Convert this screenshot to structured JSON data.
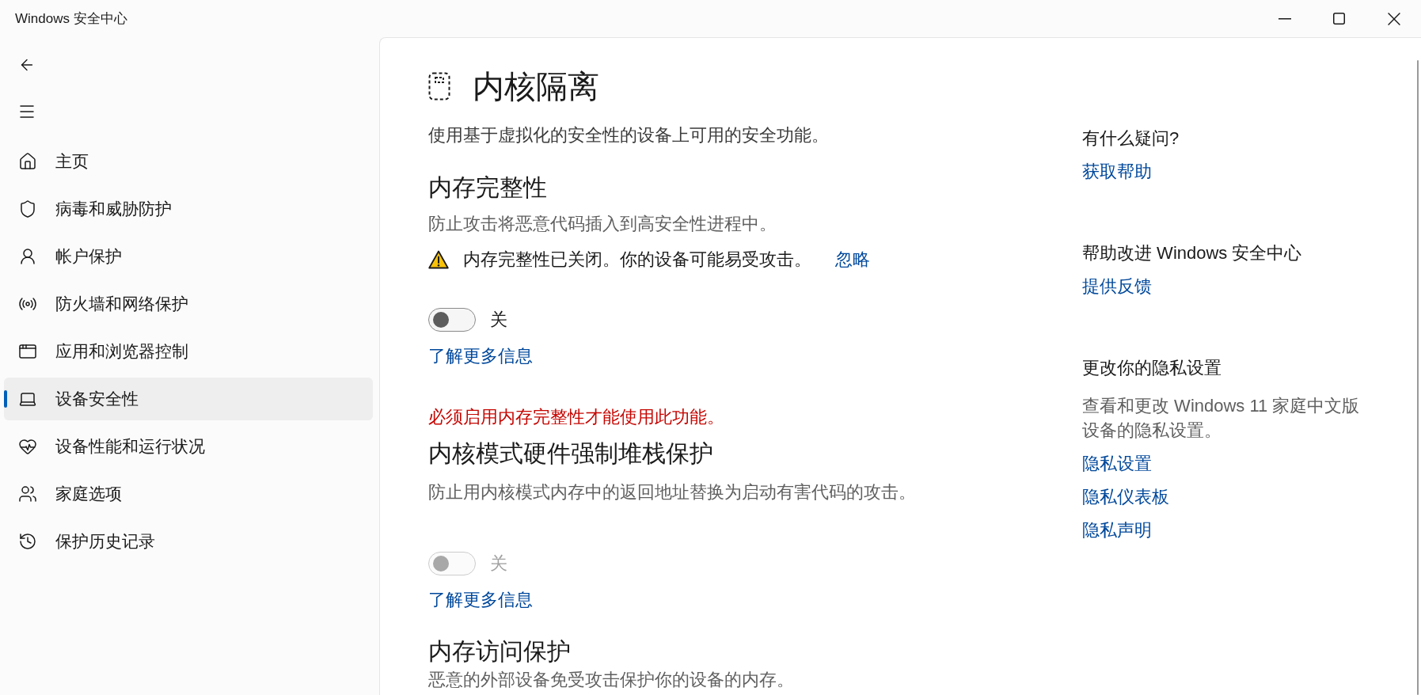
{
  "window": {
    "title": "Windows 安全中心"
  },
  "sidebar": {
    "items": [
      {
        "label": "主页",
        "selected": false
      },
      {
        "label": "病毒和威胁防护",
        "selected": false
      },
      {
        "label": "帐户保护",
        "selected": false
      },
      {
        "label": "防火墙和网络保护",
        "selected": false
      },
      {
        "label": "应用和浏览器控制",
        "selected": false
      },
      {
        "label": "设备安全性",
        "selected": true
      },
      {
        "label": "设备性能和运行状况",
        "selected": false
      },
      {
        "label": "家庭选项",
        "selected": false
      },
      {
        "label": "保护历史记录",
        "selected": false
      }
    ]
  },
  "page": {
    "title": "内核隔离",
    "description": "使用基于虚拟化的安全性的设备上可用的安全功能。"
  },
  "sections": [
    {
      "heading": "内存完整性",
      "description": "防止攻击将恶意代码插入到高安全性进程中。",
      "warning": {
        "text": "内存完整性已关闭。你的设备可能易受攻击。",
        "link": "忽略"
      },
      "toggle": {
        "on": false,
        "disabled": false,
        "label": "关"
      },
      "link": "了解更多信息"
    },
    {
      "notice": "必须启用内存完整性才能使用此功能。",
      "heading": "内核模式硬件强制堆栈保护",
      "description": "防止用内核模式内存中的返回地址替换为启动有害代码的攻击。",
      "toggle": {
        "on": false,
        "disabled": true,
        "label": "关"
      },
      "link": "了解更多信息"
    },
    {
      "heading": "内存访问保护",
      "description": "恶意的外部设备免受攻击保护你的设备的内存。"
    }
  ],
  "aside": {
    "groups": [
      {
        "heading": "有什么疑问?",
        "links": [
          "获取帮助"
        ]
      },
      {
        "heading": "帮助改进 Windows 安全中心",
        "links": [
          "提供反馈"
        ]
      },
      {
        "heading": "更改你的隐私设置",
        "description": "查看和更改 Windows 11 家庭中文版设备的隐私设置。",
        "links": [
          "隐私设置",
          "隐私仪表板",
          "隐私声明"
        ]
      }
    ]
  }
}
